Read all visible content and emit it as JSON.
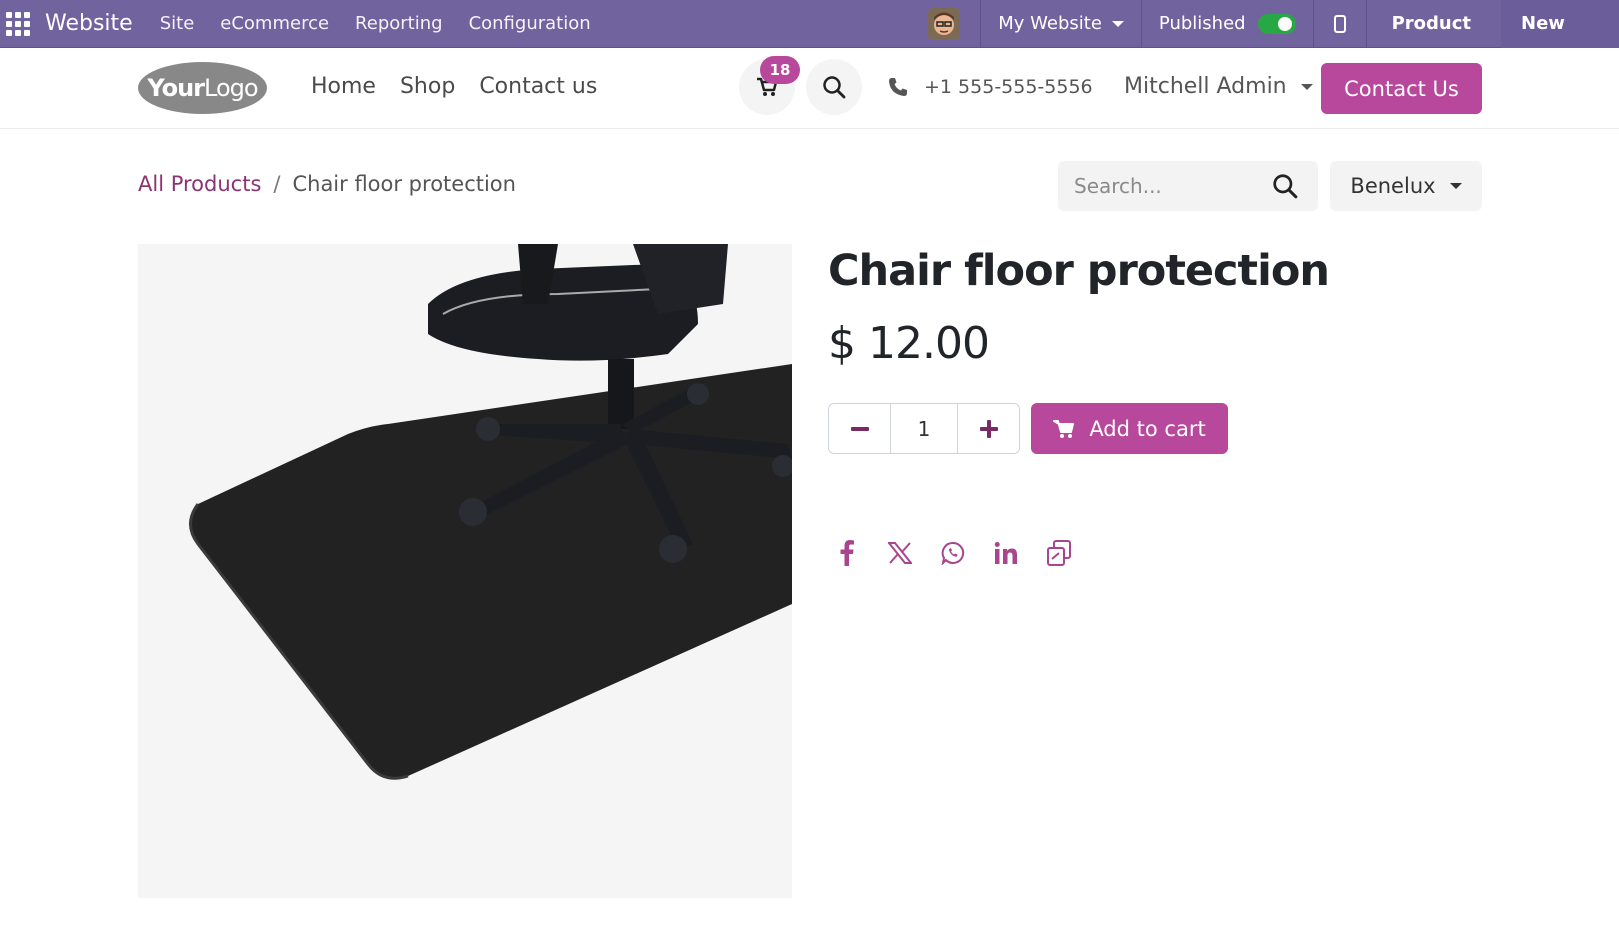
{
  "admin_bar": {
    "app_name": "Website",
    "menu": [
      "Site",
      "eCommerce",
      "Reporting",
      "Configuration"
    ],
    "website_selector": "My Website",
    "published_label": "Published",
    "published": true,
    "product_label": "Product",
    "new_label": "New"
  },
  "header": {
    "logo_bold": "Your",
    "logo_light": "Logo",
    "nav": [
      "Home",
      "Shop",
      "Contact us"
    ],
    "cart_count": "18",
    "phone": "+1 555-555-5556",
    "user": "Mitchell Admin",
    "contact_button": "Contact Us"
  },
  "breadcrumb": {
    "parent": "All Products",
    "separator": "/",
    "current": "Chair floor protection"
  },
  "search": {
    "placeholder": "Search..."
  },
  "pricelist": "Benelux",
  "product": {
    "name": "Chair floor protection",
    "price": "$ 12.00",
    "quantity": "1",
    "add_to_cart": "Add to cart"
  },
  "share_icons": [
    "facebook-icon",
    "x-icon",
    "whatsapp-icon",
    "linkedin-icon",
    "copy-link-icon"
  ],
  "colors": {
    "admin_bar": "#71639e",
    "accent": "#b8489b",
    "link": "#8c3473"
  }
}
